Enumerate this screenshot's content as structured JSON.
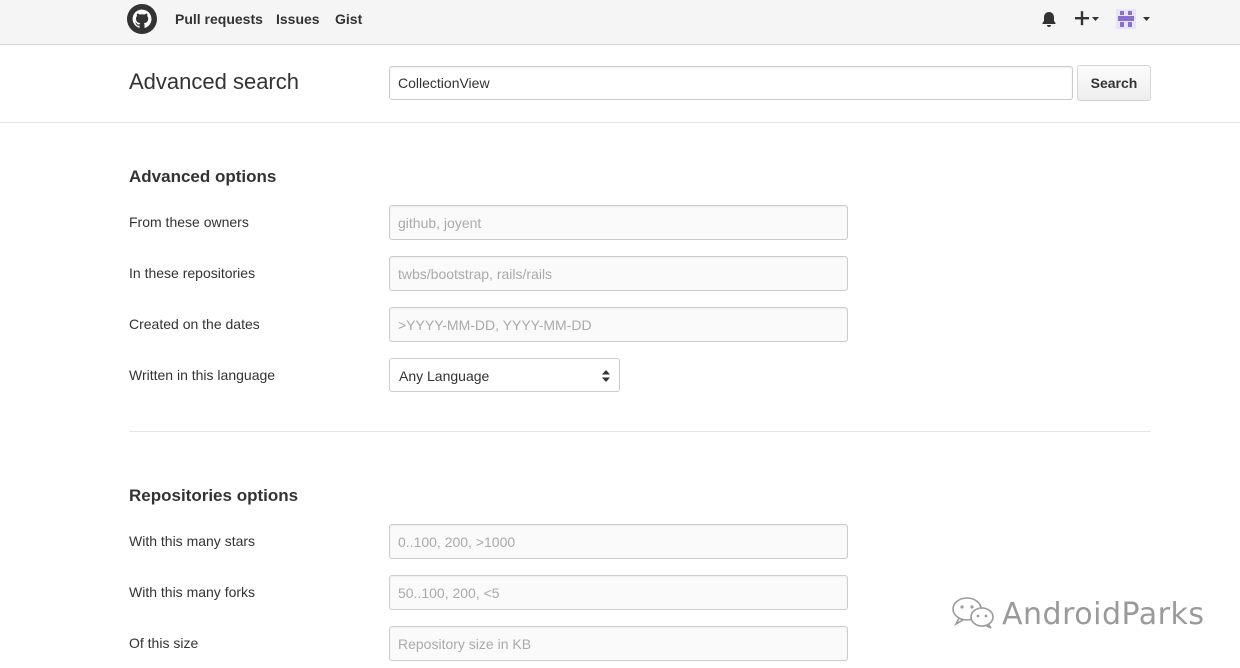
{
  "topnav": {
    "pull_requests": "Pull requests",
    "issues": "Issues",
    "gist": "Gist",
    "icons": [
      "github-logo-icon",
      "bell-icon",
      "plus-icon",
      "avatar"
    ]
  },
  "search": {
    "title": "Advanced search",
    "query": "CollectionView",
    "button_label": "Search"
  },
  "advanced_options": {
    "title": "Advanced options",
    "owners_label": "From these owners",
    "owners_placeholder": "github, joyent",
    "repos_label": "In these repositories",
    "repos_placeholder": "twbs/bootstrap, rails/rails",
    "dates_label": "Created on the dates",
    "dates_placeholder": ">YYYY-MM-DD, YYYY-MM-DD",
    "language_label": "Written in this language",
    "language_value": "Any Language"
  },
  "repo_options": {
    "title": "Repositories options",
    "stars_label": "With this many stars",
    "stars_placeholder": "0..100, 200, >1000",
    "forks_label": "With this many forks",
    "forks_placeholder": "50..100, 200, <5",
    "size_label": "Of this size",
    "size_placeholder": "Repository size in KB"
  },
  "watermark": {
    "text": "AndroidParks"
  },
  "colors": {
    "topbar_bg": "#f5f5f5",
    "text": "#333333",
    "placeholder": "#aaaaaa",
    "avatar": "#8a6fd1"
  }
}
